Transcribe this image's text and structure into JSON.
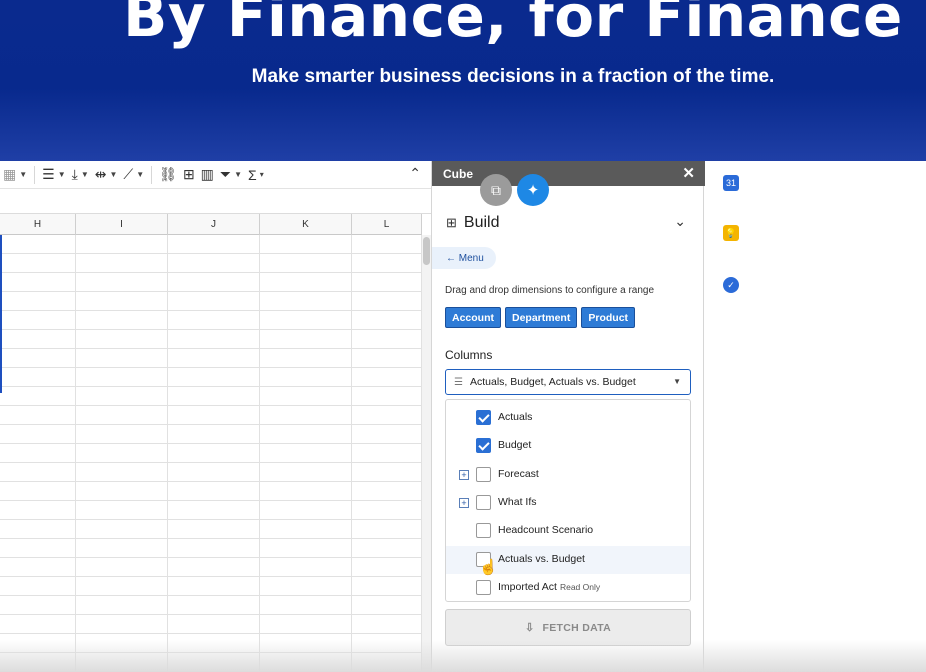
{
  "hero": {
    "title": "By Finance, for Finance",
    "subtitle": "Make smarter business decisions in a fraction of the time."
  },
  "sheet": {
    "toolbar_icons": [
      "borders-icon",
      "align-horizontal-icon",
      "align-vertical-icon",
      "text-wrap-icon",
      "text-rotate-icon",
      "link-icon",
      "insert-comment-icon",
      "insert-chart-icon",
      "filter-icon",
      "functions-icon"
    ],
    "columns": [
      "H",
      "I",
      "J",
      "K",
      "L"
    ],
    "row_count": 23
  },
  "panel": {
    "title": "Cube",
    "close": "✕",
    "build_label": "Build",
    "menu_label": "← Menu",
    "drag_hint": "Drag and drop dimensions to configure a range",
    "dimensions": [
      "Account",
      "Department",
      "Product"
    ],
    "columns_label": "Columns",
    "columns_value": "Actuals, Budget, Actuals vs. Budget",
    "options": [
      {
        "label": "Actuals",
        "checked": true,
        "expandable": false
      },
      {
        "label": "Budget",
        "checked": true,
        "expandable": false
      },
      {
        "label": "Forecast",
        "checked": false,
        "expandable": true
      },
      {
        "label": "What Ifs",
        "checked": false,
        "expandable": true
      },
      {
        "label": "Headcount Scenario",
        "checked": false,
        "expandable": false
      },
      {
        "label": "Actuals vs. Budget",
        "checked": false,
        "expandable": false,
        "hover": true
      },
      {
        "label": "Imported Act",
        "tag": "Read Only",
        "checked": false,
        "expandable": false
      }
    ],
    "fetch_label": "FETCH DATA"
  },
  "rail": {
    "calendar_day": "31"
  }
}
